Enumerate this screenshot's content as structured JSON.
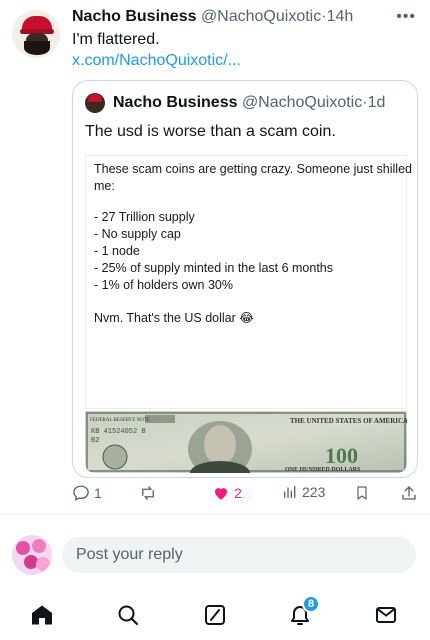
{
  "tweet": {
    "author_name": "Nacho Business",
    "author_handle": "@NachoQuixotic",
    "separator": "·",
    "time": "14h",
    "text": "I'm flattered.",
    "link": "x.com/NachoQuixotic/..."
  },
  "quote": {
    "author_name": "Nacho Business",
    "author_handle": "@NachoQuixotic",
    "separator": "·",
    "time": "1d",
    "text": "The usd is worse than a scam coin.",
    "note_lines": [
      "These scam coins are getting crazy. Someone just shilled",
      "me:",
      "- 27 Trillion supply",
      "- No supply cap",
      "- 1 node",
      "- 25% of supply minted in the last 6 months",
      "- 1% of holders own 30%",
      "Nvm. That's the US dollar 😂"
    ],
    "bill": {
      "top_left": "FEDERAL RESERVE NOTE",
      "serial": "KB 41524052 B",
      "district": "B2",
      "country": "THE UNITED STATES OF AMERICA",
      "denomination": "100",
      "bottom": "ONE HUNDRED DOLLARS"
    }
  },
  "actions": {
    "replies": "1",
    "reposts": "",
    "likes": "2",
    "views": "223"
  },
  "reply": {
    "placeholder": "Post your reply"
  },
  "nav": {
    "notifications_badge": "8"
  },
  "colors": {
    "accent": "#1d9bf0",
    "like": "#f91880",
    "text_secondary": "#536471"
  }
}
